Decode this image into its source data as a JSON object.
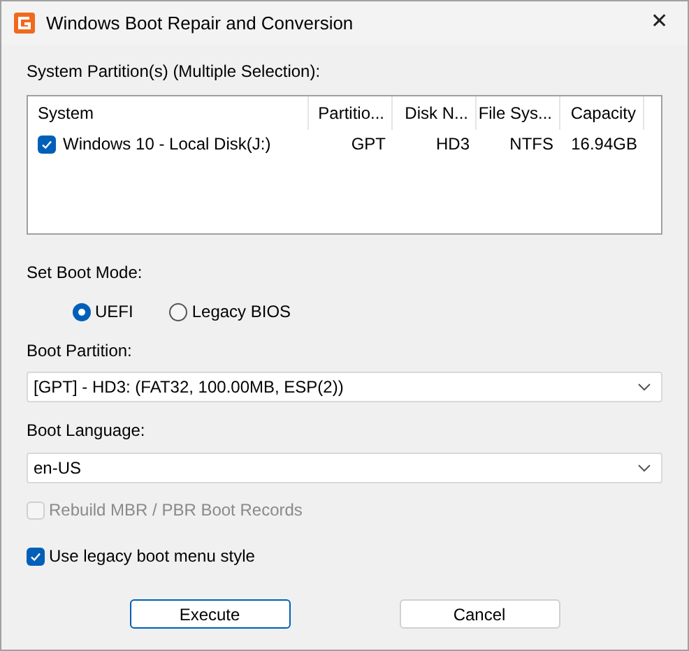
{
  "window": {
    "title": "Windows Boot Repair and Conversion",
    "close": "✕"
  },
  "partitions": {
    "label": "System Partition(s) (Multiple Selection):",
    "columns": [
      "System",
      "Partitio...",
      "Disk N...",
      "File Sys...",
      "Capacity"
    ],
    "rows": [
      {
        "checked": true,
        "cells": [
          "Windows 10 - Local Disk(J:)",
          "GPT",
          "HD3",
          "NTFS",
          "16.94GB"
        ]
      }
    ]
  },
  "boot_mode": {
    "label": "Set Boot Mode:",
    "options": [
      {
        "label": "UEFI",
        "selected": true
      },
      {
        "label": "Legacy BIOS",
        "selected": false
      }
    ]
  },
  "boot_partition": {
    "label": "Boot Partition:",
    "value": "[GPT] - HD3: (FAT32, 100.00MB, ESP(2))"
  },
  "boot_language": {
    "label": "Boot Language:",
    "value": "en-US"
  },
  "options": [
    {
      "label": "Rebuild MBR / PBR Boot Records",
      "checked": false,
      "disabled": true
    },
    {
      "label": "Use legacy boot menu style",
      "checked": true,
      "disabled": false
    }
  ],
  "buttons": [
    {
      "label": "Execute",
      "default": true
    },
    {
      "label": "Cancel",
      "default": false
    }
  ]
}
